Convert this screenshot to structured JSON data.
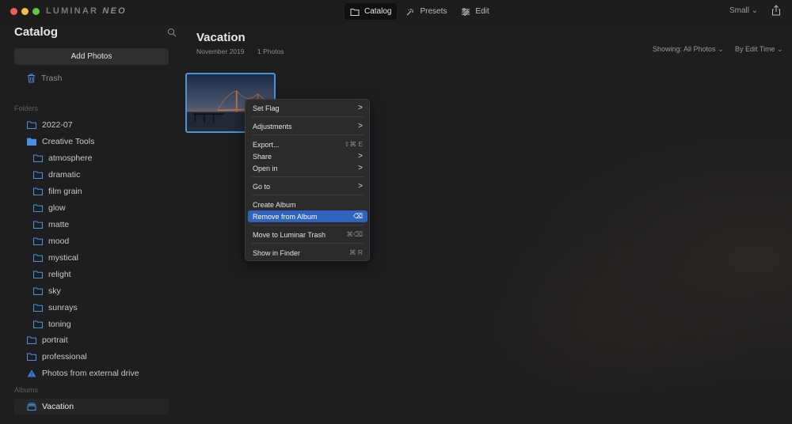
{
  "app": {
    "brand": "LUMINAR",
    "brand_suffix": "NEO"
  },
  "topnav": [
    {
      "label": "Catalog",
      "icon": "folder-icon"
    },
    {
      "label": "Presets",
      "icon": "sparkle-icon"
    },
    {
      "label": "Edit",
      "icon": "sliders-icon"
    }
  ],
  "size_selector": "Small",
  "sidebar": {
    "title": "Catalog",
    "add_photos": "Add Photos",
    "trash": "Trash",
    "folders_label": "Folders",
    "folders": [
      {
        "label": "2022-07"
      },
      {
        "label": "Creative Tools"
      },
      {
        "label": "atmosphere"
      },
      {
        "label": "dramatic"
      },
      {
        "label": "film grain"
      },
      {
        "label": "glow"
      },
      {
        "label": "matte"
      },
      {
        "label": "mood"
      },
      {
        "label": "mystical"
      },
      {
        "label": "relight"
      },
      {
        "label": "sky"
      },
      {
        "label": "sunrays"
      },
      {
        "label": "toning"
      },
      {
        "label": "portrait"
      },
      {
        "label": "professional"
      },
      {
        "label": "Photos from external drive"
      }
    ],
    "albums_label": "Albums",
    "albums": [
      {
        "label": "Vacation"
      }
    ]
  },
  "main": {
    "title": "Vacation",
    "date": "November 2019",
    "count": "1 Photos",
    "showing": "Showing: All Photos",
    "sort": "By Edit Time"
  },
  "context_menu": {
    "items": [
      {
        "label": "Set Flag",
        "submenu": ">"
      },
      {
        "label": "Adjustments",
        "submenu": ">"
      },
      {
        "label": "Export...",
        "shortcut": "⇧⌘ E"
      },
      {
        "label": "Share",
        "submenu": ">"
      },
      {
        "label": "Open in",
        "submenu": ">"
      },
      {
        "label": "Go to",
        "submenu": ">"
      },
      {
        "label": "Create Album"
      },
      {
        "label": "Remove from Album",
        "shortcut": "⌫"
      },
      {
        "label": "Move to Luminar Trash",
        "shortcut": "⌘⌫"
      },
      {
        "label": "Show in Finder",
        "shortcut": "⌘ R"
      }
    ]
  },
  "colors": {
    "accent": "#2f63bd",
    "selection_border": "#4a95d8",
    "warning": "#3b7ddd"
  }
}
